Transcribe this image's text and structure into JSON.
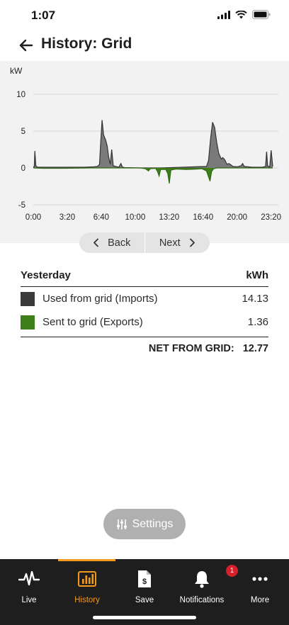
{
  "status": {
    "time": "1:07"
  },
  "header": {
    "title": "History: Grid"
  },
  "chart_data": {
    "type": "area",
    "ylabel": "kW",
    "ylim": [
      -5,
      10
    ],
    "yticks": [
      "10",
      "5",
      "0",
      "-5"
    ],
    "xticks": [
      "0:00",
      "3:20",
      "6:40",
      "10:00",
      "13:20",
      "16:40",
      "20:00",
      "23:20"
    ],
    "xlim_hours": [
      0,
      23.5
    ],
    "series": [
      {
        "color": "#7a7a7a",
        "points": [
          [
            0,
            0.1
          ],
          [
            0.1,
            0.2
          ],
          [
            0.15,
            2.3
          ],
          [
            0.25,
            0.3
          ],
          [
            0.4,
            0.1
          ],
          [
            2,
            0.1
          ],
          [
            4,
            0.1
          ],
          [
            5,
            0.1
          ],
          [
            6,
            0.15
          ],
          [
            6.3,
            0.2
          ],
          [
            6.5,
            0.5
          ],
          [
            6.6,
            3
          ],
          [
            6.75,
            6.5
          ],
          [
            6.9,
            4.5
          ],
          [
            7.1,
            3.8
          ],
          [
            7.25,
            3
          ],
          [
            7.4,
            1.5
          ],
          [
            7.55,
            0.5
          ],
          [
            7.7,
            2.5
          ],
          [
            7.85,
            0.3
          ],
          [
            8.1,
            0.2
          ],
          [
            8.4,
            0.1
          ],
          [
            8.6,
            0.6
          ],
          [
            8.75,
            0.1
          ],
          [
            9,
            0.05
          ],
          [
            10.5,
            0
          ],
          [
            12.5,
            0
          ],
          [
            17,
            0.2
          ],
          [
            17.2,
            1
          ],
          [
            17.4,
            4
          ],
          [
            17.6,
            6.2
          ],
          [
            17.8,
            5.5
          ],
          [
            18,
            3.5
          ],
          [
            18.2,
            2
          ],
          [
            18.45,
            1.2
          ],
          [
            18.6,
            1.4
          ],
          [
            18.8,
            1.1
          ],
          [
            19,
            0.5
          ],
          [
            19.2,
            0.6
          ],
          [
            19.4,
            0.4
          ],
          [
            19.6,
            0.2
          ],
          [
            20,
            0.15
          ],
          [
            20.4,
            0.3
          ],
          [
            20.55,
            0.6
          ],
          [
            20.7,
            0.2
          ],
          [
            21.5,
            0.1
          ],
          [
            22.5,
            0.1
          ],
          [
            22.8,
            0.2
          ],
          [
            22.9,
            2.2
          ],
          [
            23,
            0.3
          ],
          [
            23.2,
            0.1
          ],
          [
            23.35,
            2.4
          ],
          [
            23.5,
            0.2
          ]
        ]
      },
      {
        "color": "#3e7f1a",
        "points": [
          [
            0,
            0
          ],
          [
            1,
            -0.05
          ],
          [
            3,
            -0.05
          ],
          [
            6,
            0
          ],
          [
            10.5,
            0
          ],
          [
            11,
            -0.1
          ],
          [
            11.3,
            -0.4
          ],
          [
            11.5,
            -0.1
          ],
          [
            12,
            -0.05
          ],
          [
            12.2,
            -0.5
          ],
          [
            12.35,
            -1.1
          ],
          [
            12.5,
            -0.2
          ],
          [
            13,
            -0.2
          ],
          [
            13.2,
            -0.8
          ],
          [
            13.35,
            -2.1
          ],
          [
            13.5,
            -0.3
          ],
          [
            14,
            -0.15
          ],
          [
            15,
            -0.2
          ],
          [
            16,
            -0.15
          ],
          [
            16.5,
            -0.1
          ],
          [
            16.7,
            -0.2
          ],
          [
            17,
            -0.4
          ],
          [
            17.2,
            -1.2
          ],
          [
            17.35,
            -1.8
          ],
          [
            17.5,
            -0.5
          ],
          [
            17.7,
            -0.1
          ],
          [
            18,
            0
          ],
          [
            23.5,
            0
          ]
        ]
      }
    ]
  },
  "nav": {
    "back": "Back",
    "next": "Next"
  },
  "summary": {
    "period": "Yesterday",
    "unit": "kWh",
    "rows": [
      {
        "label": "Used from grid (Imports)",
        "value": "14.13",
        "color": "#3a3a3a"
      },
      {
        "label": "Sent to grid (Exports)",
        "value": "1.36",
        "color": "#3e7f1a"
      }
    ],
    "net_label": "NET FROM GRID:",
    "net_value": "12.77"
  },
  "settings": {
    "label": "Settings"
  },
  "tabs": [
    {
      "label": "Live",
      "icon": "pulse-icon"
    },
    {
      "label": "History",
      "icon": "bar-chart-icon",
      "active": true
    },
    {
      "label": "Save",
      "icon": "dollar-document-icon"
    },
    {
      "label": "Notifications",
      "icon": "bell-icon",
      "badge": "1"
    },
    {
      "label": "More",
      "icon": "more-dots-icon"
    }
  ],
  "colors": {
    "accent": "#f39a1e",
    "badge": "#d4202c"
  }
}
